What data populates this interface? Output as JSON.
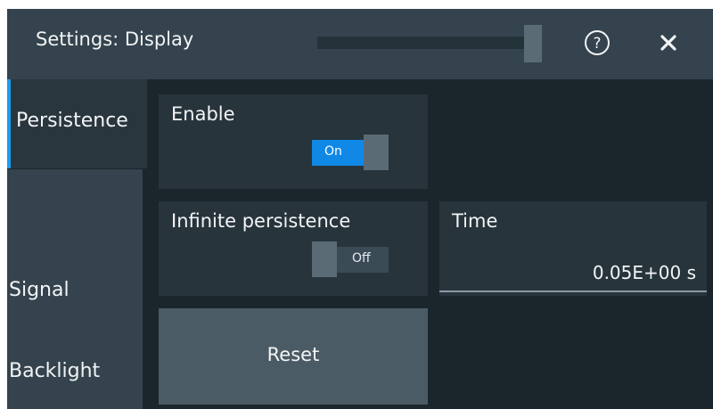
{
  "header": {
    "title": "Settings: Display",
    "help_icon": "help-circle-icon",
    "close_icon": "close-icon"
  },
  "sidebar": {
    "items": [
      {
        "label": "Persistence",
        "active": true
      },
      {
        "label": "Signal",
        "active": false
      },
      {
        "label": "Backlight",
        "active": false
      }
    ]
  },
  "persistence": {
    "enable": {
      "label": "Enable",
      "state": "On"
    },
    "infinite": {
      "label": "Infinite persistence",
      "state": "Off"
    },
    "time": {
      "label": "Time",
      "value": "0.05E+00 s"
    },
    "reset_label": "Reset"
  },
  "colors": {
    "accent": "#1089e6",
    "background": "#1b252c",
    "header": "#34434d",
    "panel": "#27343c"
  }
}
